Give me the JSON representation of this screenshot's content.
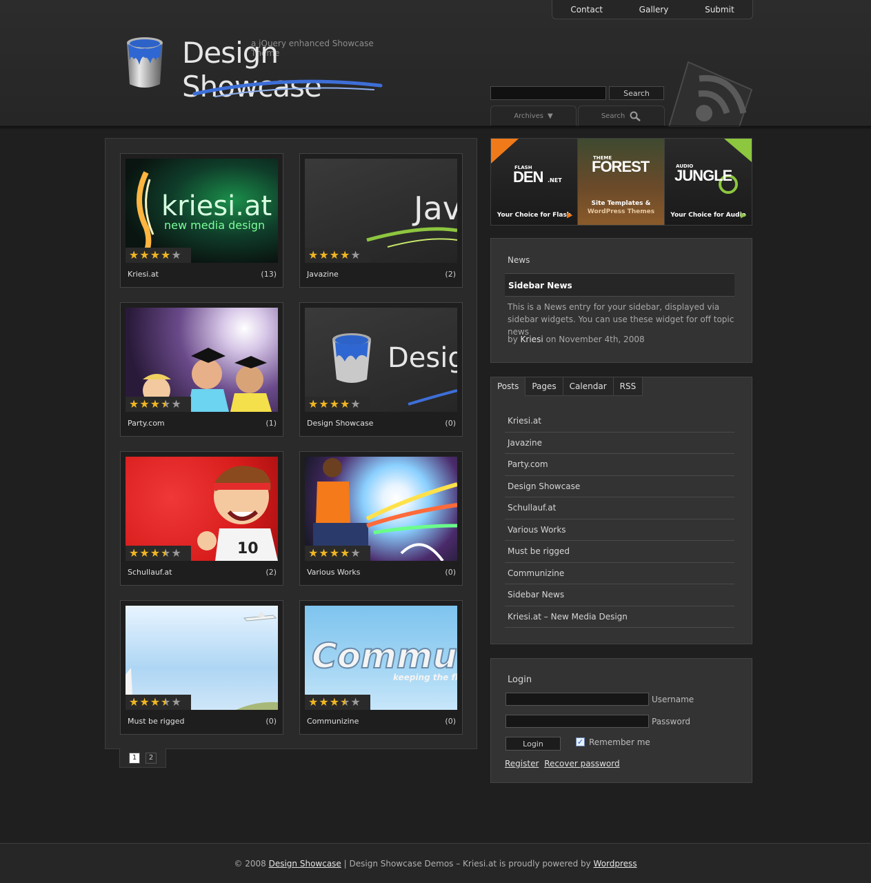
{
  "topnav": {
    "contact": "Contact",
    "gallery": "Gallery",
    "submit": "Submit"
  },
  "logo": {
    "tagline": "a jQuery enhanced Showcase Theme",
    "title": "Design Showcase"
  },
  "search": {
    "button": "Search",
    "value": ""
  },
  "header_tabs": {
    "archives": "Archives",
    "search": "Search"
  },
  "gallery": {
    "items": [
      {
        "name": "Kriesi.at",
        "count": "(13)",
        "rating": 4,
        "thumb_text": "kriesi.at",
        "thumb_sub": "new media design"
      },
      {
        "name": "Javazine",
        "count": "(2)",
        "rating": 4,
        "thumb_text": "Jav"
      },
      {
        "name": "Party.com",
        "count": "(1)",
        "rating": 3.5
      },
      {
        "name": "Design Showcase",
        "count": "(0)",
        "rating": 4,
        "thumb_text": "Desig"
      },
      {
        "name": "Schullauf.at",
        "count": "(2)",
        "rating": 3.5
      },
      {
        "name": "Various Works",
        "count": "(0)",
        "rating": 4
      },
      {
        "name": "Must be rigged",
        "count": "(0)",
        "rating": 3.5
      },
      {
        "name": "Communizine",
        "count": "(0)",
        "rating": 3.5,
        "thumb_text": "Commu",
        "thumb_sub": "keeping the fl"
      }
    ],
    "pages": [
      "1",
      "2"
    ]
  },
  "ads": [
    {
      "small": "FLASH",
      "big": "DEN",
      "suffix": ".NET",
      "caption": "Your Choice for Flash"
    },
    {
      "small": "THEME",
      "big": "FOREST",
      "caption": "Site Templates &",
      "caption2": "WordPress Themes"
    },
    {
      "small": "AUDIO",
      "big": "JUNGLE",
      "caption": "Your Choice for Audio"
    }
  ],
  "news": {
    "title": "News",
    "heading": "Sidebar News",
    "body": "This is a News entry for your sidebar, displayed via sidebar widgets. You can use these widget for off topic news",
    "meta_prefix": "by",
    "author": "Kriesi",
    "meta_suffix": "on November 4th, 2008"
  },
  "tabs": {
    "labels": [
      "Posts",
      "Pages",
      "Calendar",
      "RSS"
    ],
    "posts": [
      "Kriesi.at",
      "Javazine",
      "Party.com",
      "Design Showcase",
      "Schullauf.at",
      "Various Works",
      "Must be rigged",
      "Communizine",
      "Sidebar News",
      "Kriesi.at – New Media Design"
    ]
  },
  "login": {
    "title": "Login",
    "username_label": "Username",
    "password_label": "Password",
    "button": "Login",
    "remember": "Remember me",
    "register": "Register",
    "recover": "Recover password"
  },
  "footer": {
    "prefix": "© 2008",
    "site_link": "Design Showcase",
    "middle": "| Design Showcase Demos – Kriesi.at is proudly powered by",
    "wp_link": "Wordpress"
  }
}
